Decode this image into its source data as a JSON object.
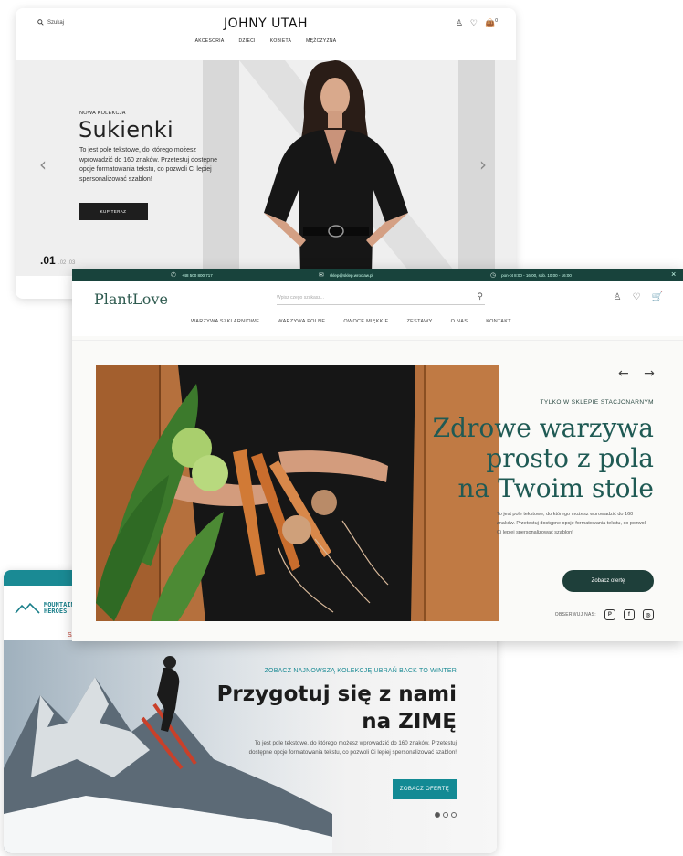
{
  "johny_utah": {
    "search_label": "Szukaj",
    "logo": "JOHNY UTAH",
    "icons": [
      "user-icon",
      "heart-icon",
      "bag-icon"
    ],
    "cart_count": "0",
    "nav": [
      "AKCESORIA",
      "DZIECI",
      "KOBIETA",
      "MĘŻCZYZNA"
    ],
    "hero": {
      "eyebrow": "NOWA KOLEKCJA",
      "title": "Sukienki",
      "description": "To jest pole tekstowe, do którego możesz wprowadzić do 160 znaków. Przetestuj dostępne opcje formatowania tekstu, co pozwoli Ci lepiej spersonalizować szablon!",
      "button": "KUP TERAZ",
      "prev_arrow": "‹",
      "next_arrow": "›",
      "current_slide": ".01",
      "other_slides": ".02 .03"
    }
  },
  "plantlove": {
    "topbar": {
      "phone": "+48 500 800 717",
      "email": "sklep@sklep.wroclaw.pl",
      "hours": "pon-pt 8:00 - 16:00, sob. 10:00 - 16:00",
      "close": "×"
    },
    "logo": "PlantLove",
    "search_placeholder": "Wpisz czego szukasz...",
    "nav": [
      "WARZYWA SZKLARNIOWE",
      "WARZYWA POLNE",
      "OWOCE MIĘKKIE",
      "ZESTAWY",
      "O NAS",
      "KONTAKT"
    ],
    "hero": {
      "arrows": "← →",
      "eyebrow": "TYLKO W SKLEPIE STACJONARNYM",
      "title_lines": [
        "Zdrowe warzywa",
        "prosto z pola",
        "na Twoim stole"
      ],
      "description": "To jest pole tekstowe, do którego możesz wprowadzić do 160 znaków. Przetestuj dostępne opcje formatowania tekstu, co pozwoli Ci lepiej spersonalizować szablon!",
      "button": "Zobacz ofertę",
      "social_label": "OBSERWUJ NAS:"
    },
    "accent_color": "#1f5a54"
  },
  "mountain_heroes": {
    "logo_line1": "MOUNTAIN",
    "logo_line2": "HEROES",
    "nav_partial": "SA",
    "hero": {
      "eyebrow": "ZOBACZ NAJNOWSZĄ KOLEKCJĘ UBRAŃ BACK TO WINTER",
      "title_line1": "Przygotuj się z nami",
      "title_line2": "na ZIMĘ",
      "description": "To jest pole tekstowe, do którego możesz wprowadzić do 160 znaków. Przetestuj dostępne opcje formatowania tekstu, co pozwoli Ci lepiej spersonalizować szablon!",
      "button": "ZOBACZ OFERTĘ"
    },
    "accent_color": "#1a8a94"
  }
}
